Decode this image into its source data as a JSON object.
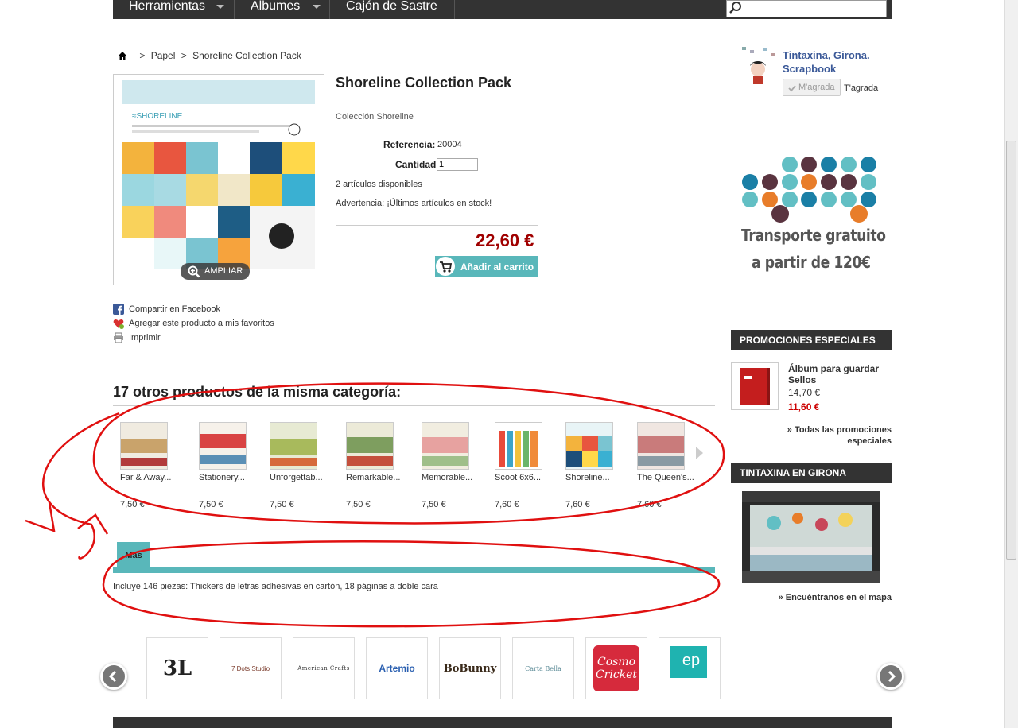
{
  "nav": {
    "items": [
      "Herramientas",
      "Albumes",
      "Cajón de Sastre"
    ],
    "search_placeholder": ""
  },
  "breadcrumb": {
    "sep1": ">",
    "category": "Papel",
    "sep2": ">",
    "current": "Shoreline Collection Pack"
  },
  "product": {
    "title": "Shoreline Collection Pack",
    "collection": "Colección Shoreline",
    "ref_label": "Referencia:",
    "ref_value": "20004",
    "qty_label": "Cantidad",
    "qty_value": "1",
    "stock": "2 artículos disponibles",
    "warning": "Advertencia: ¡Últimos artículos en stock!",
    "price": "22,60 €",
    "add_to_cart": "Añadir al carrito",
    "zoom_label": "AMPLIAR"
  },
  "share": {
    "facebook": "Compartir en Facebook",
    "favorites": "Agregar este producto a mis favoritos",
    "print": "Imprimir"
  },
  "related": {
    "heading": "17 otros productos de la misma categoría:",
    "items": [
      {
        "name": "Far & Away...",
        "price": "7,50 €"
      },
      {
        "name": "Stationery...",
        "price": "7,50 €"
      },
      {
        "name": "Unforgettab...",
        "price": "7,50 €"
      },
      {
        "name": "Remarkable...",
        "price": "7,50 €"
      },
      {
        "name": "Memorable...",
        "price": "7,50 €"
      },
      {
        "name": "Scoot 6x6...",
        "price": "7,60 €"
      },
      {
        "name": "Shoreline...",
        "price": "7,60 €"
      },
      {
        "name": "The Queen's...",
        "price": "7,60 €"
      }
    ]
  },
  "tabs": {
    "more_label": "Más",
    "content": "Incluye 146 piezas: Thickers de letras adhesivas en cartón, 18 páginas a doble cara"
  },
  "brands": [
    "3L",
    "7 Dots Studio",
    "American Crafts",
    "Artemio",
    "BoBunny",
    "Carta Bella",
    "Cosmo Cricket",
    "ep"
  ],
  "sidebar": {
    "fb_page_name": "Tintaxina, Girona. Scrapbook",
    "fb_like_label": "M'agrada",
    "fb_like_count": "T'agrada",
    "shipping_line1": "Transporte gratuito",
    "shipping_line2": "a partir de 120€",
    "specials_header": "PROMOCIONES ESPECIALES",
    "special_item_name": "Álbum para guardar Sellos",
    "special_old_price": "14,70 €",
    "special_new_price": "11,60 €",
    "all_specials": "» Todas las promociones especiales",
    "store_header": "TINTAXINA EN GIRONA",
    "map_link": "» Encuéntranos en el mapa"
  },
  "colors": {
    "accent_teal": "#59b7ba",
    "price_red": "#a00000",
    "dark_bar": "#333333",
    "annotation_red": "#e01010"
  }
}
